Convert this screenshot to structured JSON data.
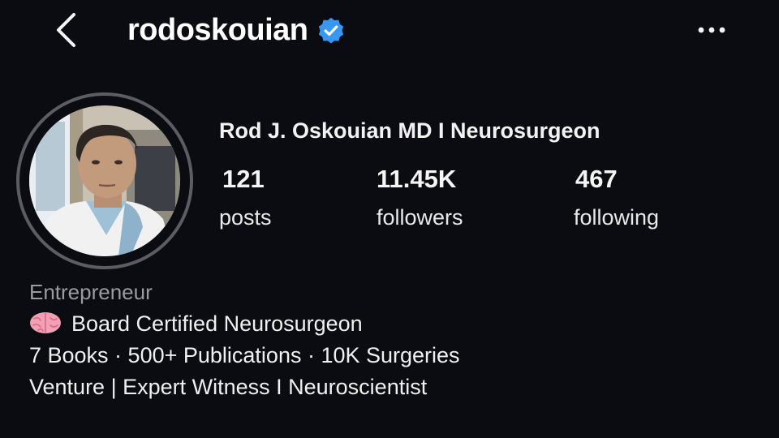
{
  "header": {
    "username": "rodoskouian",
    "verified": true,
    "icons": {
      "back": "chevron-left-icon",
      "verified": "verified-badge-icon",
      "more": "more-horizontal-icon"
    }
  },
  "profile": {
    "full_name": "Rod J. Oskouian MD I Neurosurgeon",
    "stats": {
      "posts": {
        "value": "121",
        "label": "posts"
      },
      "followers": {
        "value": "11.45K",
        "label": "followers"
      },
      "following": {
        "value": "467",
        "label": "following"
      }
    }
  },
  "bio": {
    "category": "Entrepreneur",
    "lines": [
      "Board Certified Neurosurgeon",
      "7 Books · 500+ Publications · 10K Surgeries",
      "Venture | Expert Witness I Neuroscientist"
    ],
    "line1_icon": "brain-emoji-icon"
  },
  "colors": {
    "background": "#0b0c11",
    "verified_badge": "#3897f0",
    "avatar_ring": "#5b5d63",
    "secondary_text": "#9a9ba0"
  }
}
